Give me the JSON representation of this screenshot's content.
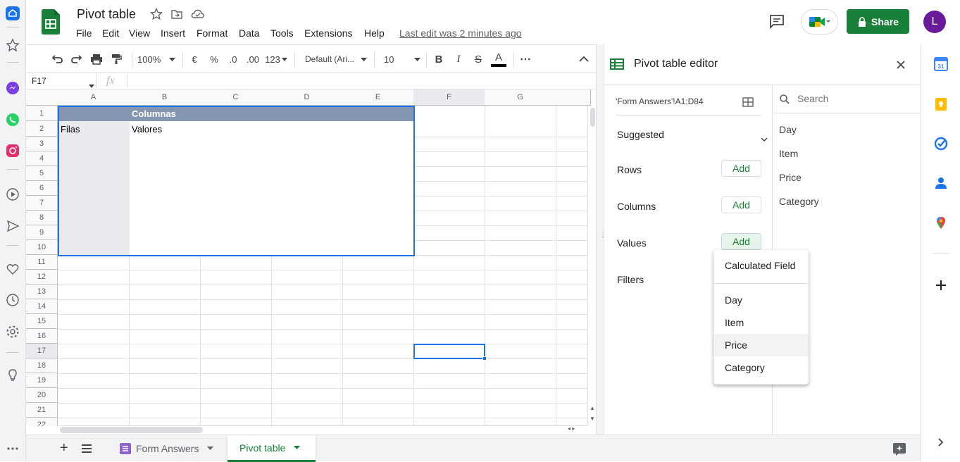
{
  "doc": {
    "title": "Pivot table",
    "last_edit": "Last edit was 2 minutes ago",
    "share_label": "Share",
    "avatar_letter": "L"
  },
  "menu": [
    "File",
    "Edit",
    "View",
    "Insert",
    "Format",
    "Data",
    "Tools",
    "Extensions",
    "Help"
  ],
  "toolbar": {
    "zoom": "100%",
    "currency": "€",
    "percent": "%",
    "decimal_decrease": ".0",
    "decimal_increase": ".00",
    "number_format": "123",
    "font": "Default (Ari...",
    "font_size": "10",
    "bold": "B",
    "italic": "I",
    "strike": "S",
    "text_color": "A",
    "more": "⋯"
  },
  "formula_bar": {
    "name_box": "F17",
    "fx": "fx",
    "value": ""
  },
  "grid": {
    "columns": [
      "A",
      "B",
      "C",
      "D",
      "E",
      "F",
      "G"
    ],
    "rows": [
      "1",
      "2",
      "3",
      "4",
      "5",
      "6",
      "7",
      "8",
      "9",
      "10",
      "11",
      "12",
      "13",
      "14",
      "15",
      "16",
      "17",
      "18",
      "19",
      "20",
      "21",
      "22"
    ],
    "cells": {
      "B1": "Columnas",
      "A2": "Filas",
      "B2": "Valores"
    },
    "selected_cell": "F17"
  },
  "sheets": [
    {
      "name": "Form Answers",
      "active": false
    },
    {
      "name": "Pivot table",
      "active": true
    }
  ],
  "panel": {
    "title": "Pivot table editor",
    "range": "'Form Answers'!A1:D84",
    "suggested": "Suggested",
    "rows_label": "Rows",
    "columns_label": "Columns",
    "values_label": "Values",
    "filters_label": "Filters",
    "add_label": "Add",
    "search_placeholder": "Search",
    "fields": [
      "Day",
      "Item",
      "Price",
      "Category"
    ]
  },
  "dropdown": {
    "calculated": "Calculated Field",
    "items": [
      "Day",
      "Item",
      "Price",
      "Category"
    ],
    "hovered": "Price"
  },
  "colors": {
    "sheets_green": "#188038",
    "share_bg": "#188038",
    "avatar_bg": "#6a1b9a",
    "pivot_header": "#8596b0",
    "pivot_label_bg": "#e8eaed",
    "selection_blue": "#1a73e8"
  }
}
